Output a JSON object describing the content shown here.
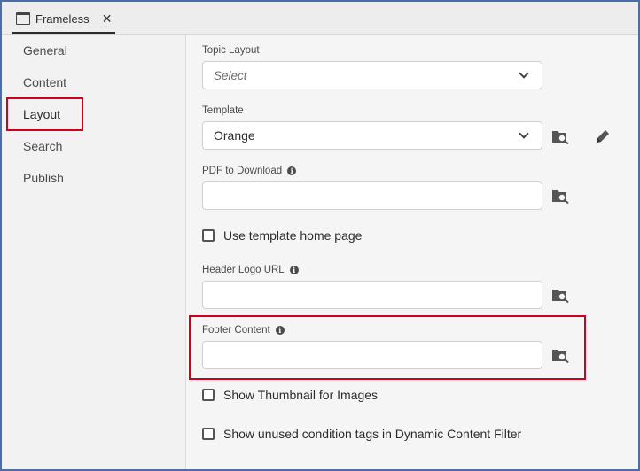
{
  "tab": {
    "title": "Frameless",
    "close_glyph": "✕"
  },
  "sidebar": {
    "items": [
      {
        "label": "General"
      },
      {
        "label": "Content"
      },
      {
        "label": "Layout"
      },
      {
        "label": "Search"
      },
      {
        "label": "Publish"
      }
    ],
    "active": "Layout"
  },
  "fields": {
    "topic_layout": {
      "label": "Topic Layout",
      "placeholder": "Select"
    },
    "template": {
      "label": "Template",
      "value": "Orange"
    },
    "pdf_to_download": {
      "label": "PDF to Download",
      "value": ""
    },
    "use_template_home": {
      "label": "Use template home page",
      "checked": false
    },
    "header_logo_url": {
      "label": "Header Logo URL",
      "value": ""
    },
    "footer_content": {
      "label": "Footer Content",
      "value": ""
    },
    "show_thumbnail": {
      "label": "Show Thumbnail for Images",
      "checked": false
    },
    "show_unused_tags": {
      "label": "Show unused condition tags in Dynamic Content Filter",
      "checked": false
    }
  },
  "icons": {
    "info": "i",
    "browse": "folder-search-icon",
    "edit": "pencil-icon"
  },
  "colors": {
    "highlight": "#d0021b",
    "frame_border": "#4a6fa5"
  }
}
